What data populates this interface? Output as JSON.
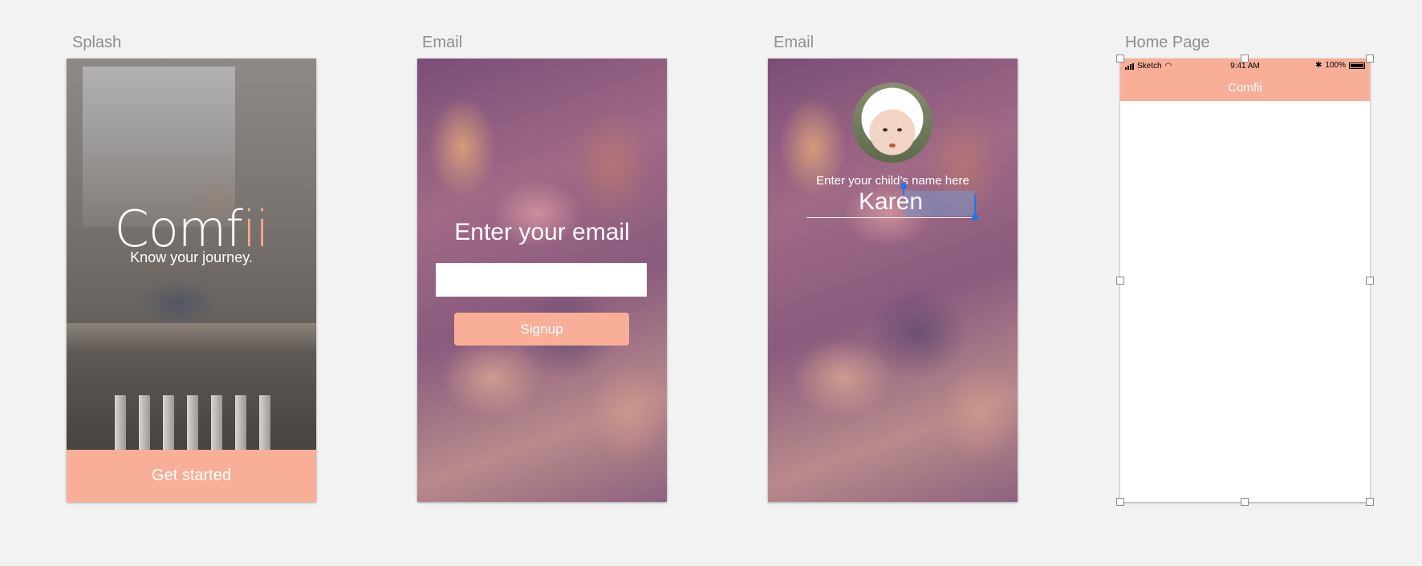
{
  "artboards": {
    "splash": {
      "label": "Splash",
      "brand_main": "Comf",
      "brand_accent": "ii",
      "tagline": "Know your journey.",
      "button": "Get started"
    },
    "email_signup": {
      "label": "Email",
      "heading": "Enter your email",
      "input_value": "",
      "button": "Signup"
    },
    "email_child": {
      "label": "Email",
      "prompt": "Enter your child’s name here",
      "name_value": "Karen"
    },
    "home": {
      "label": "Home Page",
      "status": {
        "carrier": "Sketch",
        "time": "9:41 AM",
        "battery": "100%"
      },
      "title": "Comfii"
    }
  },
  "colors": {
    "canvas": "#f2f2f2",
    "accent": "#f8ae97",
    "label": "#8e8e8e",
    "selection_handle": "#1e78e6"
  },
  "icons": [
    "signal-icon",
    "wifi-icon",
    "bluetooth-icon",
    "battery-icon"
  ]
}
